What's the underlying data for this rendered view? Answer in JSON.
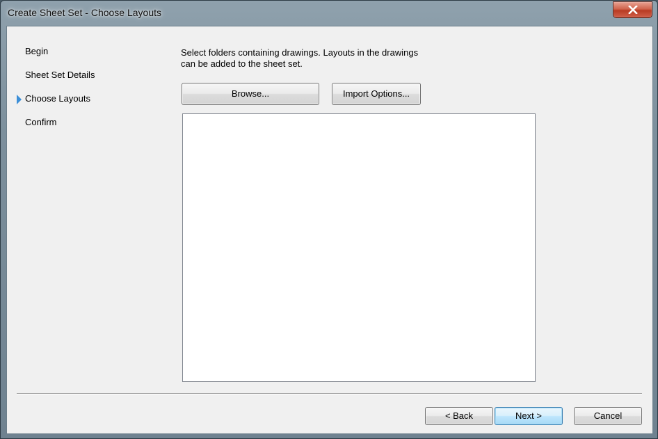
{
  "window": {
    "title": "Create Sheet Set - Choose Layouts"
  },
  "nav": {
    "items": [
      {
        "label": "Begin",
        "active": false
      },
      {
        "label": "Sheet Set Details",
        "active": false
      },
      {
        "label": "Choose Layouts",
        "active": true
      },
      {
        "label": "Confirm",
        "active": false
      }
    ]
  },
  "main": {
    "instructions_line1": "Select folders containing drawings.  Layouts in the drawings",
    "instructions_line2": "can be added to the sheet set.",
    "browse_label": "Browse...",
    "import_options_label": "Import Options..."
  },
  "footer": {
    "back_label": "< Back",
    "next_label": "Next >",
    "cancel_label": "Cancel"
  },
  "colors": {
    "active_arrow": "#3c8fd8",
    "close_button": "#c7432a"
  },
  "icons": {
    "close": "close-icon",
    "active_step": "triangle-right-icon"
  }
}
